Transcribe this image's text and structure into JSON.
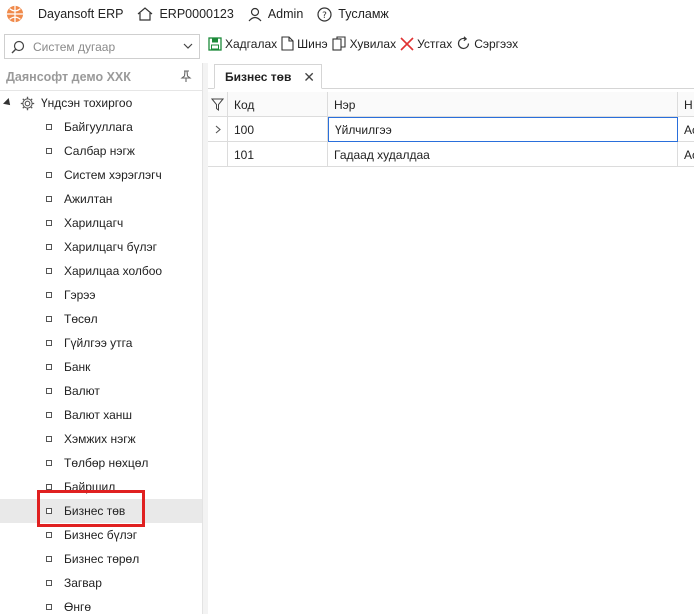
{
  "topbar": {
    "app_name": "Dayansoft ERP",
    "doc_code": "ERP0000123",
    "user": "Admin",
    "help": "Тусламж"
  },
  "search": {
    "placeholder": "Систем дугаар"
  },
  "toolbar": {
    "save": "Хадгалах",
    "new": "Шинэ",
    "copy": "Хувилах",
    "delete": "Устгах",
    "refresh": "Сэргээх"
  },
  "sidebar": {
    "company": "Даянсофт демо ХХК",
    "root": "Үндсэн тохиргоо",
    "items": [
      "Байгууллага",
      "Салбар нэгж",
      "Систем хэрэглэгч",
      "Ажилтан",
      "Харилцагч",
      "Харилцагч бүлэг",
      "Харилцаа холбоо",
      "Гэрээ",
      "Төсөл",
      "Гүйлгээ утга",
      "Банк",
      "Валют",
      "Валют ханш",
      "Хэмжих нэгж",
      "Төлбөр нөхцөл",
      "Байршил",
      "Бизнес төв",
      "Бизнес бүлэг",
      "Бизнес төрөл",
      "Загвар",
      "Өнгө"
    ],
    "selected_index": 16
  },
  "tab": {
    "label": "Бизнес төв"
  },
  "grid": {
    "columns": [
      "Код",
      "Нэр",
      "Н"
    ],
    "rows": [
      {
        "code": "100",
        "name": "Үйлчилгээ",
        "extra": "Ас"
      },
      {
        "code": "101",
        "name": "Гадаад худалдаа",
        "extra": "Ас"
      }
    ]
  }
}
